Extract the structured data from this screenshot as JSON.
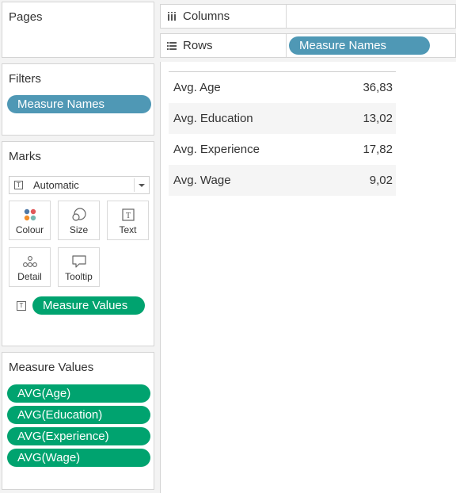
{
  "pages": {
    "title": "Pages"
  },
  "filters": {
    "title": "Filters",
    "pills": [
      "Measure Names"
    ]
  },
  "marks": {
    "title": "Marks",
    "mark_type": "Automatic",
    "buttons": {
      "colour": "Colour",
      "size": "Size",
      "text": "Text",
      "detail": "Detail",
      "tooltip": "Tooltip"
    },
    "fields": [
      "Measure Values"
    ]
  },
  "measure_values": {
    "title": "Measure Values",
    "pills": [
      "AVG(Age)",
      "AVG(Education)",
      "AVG(Experience)",
      "AVG(Wage)"
    ]
  },
  "shelves": {
    "columns": {
      "label": "Columns",
      "pills": []
    },
    "rows": {
      "label": "Rows",
      "pills": [
        "Measure Names"
      ]
    }
  },
  "view": {
    "rows": [
      {
        "name": "Avg. Age",
        "value": "36,83"
      },
      {
        "name": "Avg. Education",
        "value": "13,02"
      },
      {
        "name": "Avg. Experience",
        "value": "17,82"
      },
      {
        "name": "Avg. Wage",
        "value": "9,02"
      }
    ]
  },
  "colors": {
    "dimension_pill": "#4f98b5",
    "measure_pill": "#00a36f"
  }
}
